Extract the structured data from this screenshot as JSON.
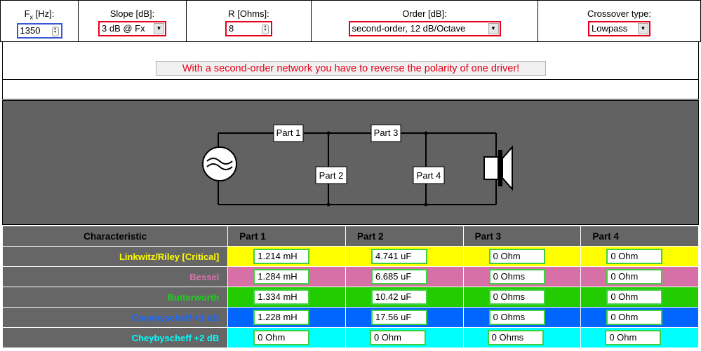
{
  "params": {
    "fx": {
      "label": "F",
      "sub": "x",
      "unit": " [Hz]:",
      "value": "1350"
    },
    "slope": {
      "label": "Slope [dB]:",
      "value": "3 dB @ Fx"
    },
    "r": {
      "label": "R [Ohms]:",
      "value": "8"
    },
    "order": {
      "label": "Order [dB]:",
      "value": "second-order, 12 dB/Octave"
    },
    "crossover": {
      "label": "Crossover type:",
      "value": "Lowpass"
    }
  },
  "warning": "With a second-order network you have to reverse the polarity of one driver!",
  "diagram": {
    "parts": [
      "Part 1",
      "Part 2",
      "Part 3",
      "Part 4"
    ]
  },
  "table": {
    "headers": [
      "Characteristic",
      "Part 1",
      "Part 2",
      "Part 3",
      "Part 4"
    ],
    "rows": [
      {
        "name": "Linkwitz/Riley [Critical]",
        "name_color": "#ffff00",
        "bg": "#ffff00",
        "values": [
          "1.214 mH",
          "4.741 uF",
          "0 Ohm",
          "0 Ohm"
        ]
      },
      {
        "name": "Bessel",
        "name_color": "#e070b0",
        "bg": "#d870a8",
        "values": [
          "1.284 mH",
          "6.685 uF",
          "0 Ohms",
          "0 Ohm"
        ]
      },
      {
        "name": "Butterworth",
        "name_color": "#22cc22",
        "bg": "#22cc00",
        "values": [
          "1.334 mH",
          "10.42 uF",
          "0 Ohms",
          "0 Ohm"
        ]
      },
      {
        "name": "Cheybyscheff +1 dB",
        "name_color": "#1a66ff",
        "bg": "#0066ff",
        "values": [
          "1.228 mH",
          "17.56 uF",
          "0 Ohms",
          "0 Ohm"
        ]
      },
      {
        "name": "Cheybyscheff +2 dB",
        "name_color": "#00ffff",
        "bg": "#00ffff",
        "values": [
          "0 Ohm",
          "0 Ohm",
          "0 Ohms",
          "0 Ohm"
        ]
      }
    ]
  }
}
